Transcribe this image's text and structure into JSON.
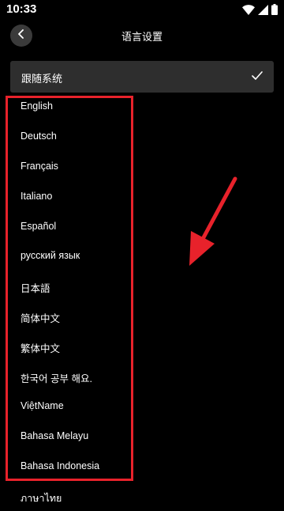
{
  "status_bar": {
    "time": "10:33",
    "icons": [
      "wifi-icon",
      "signal-icon",
      "battery-icon"
    ]
  },
  "header": {
    "back_icon": "chevron-left-icon",
    "title": "语言设置"
  },
  "selected_option": {
    "label": "跟随系统",
    "icon": "check-icon"
  },
  "languages": [
    {
      "label": "English"
    },
    {
      "label": "Deutsch"
    },
    {
      "label": "Français"
    },
    {
      "label": "Italiano"
    },
    {
      "label": "Español"
    },
    {
      "label": "русский язык"
    },
    {
      "label": "日本語"
    },
    {
      "label": "简体中文"
    },
    {
      "label": "繁体中文"
    },
    {
      "label": "한국어 공부 해요."
    },
    {
      "label": "ViệtName"
    },
    {
      "label": "Bahasa Melayu"
    },
    {
      "label": "Bahasa Indonesia"
    },
    {
      "label": "ภาษาไทย"
    }
  ],
  "colors": {
    "background": "#000000",
    "row_background": "#2e2e2e",
    "annotation_red": "#e8222b",
    "text": "#ffffff"
  }
}
